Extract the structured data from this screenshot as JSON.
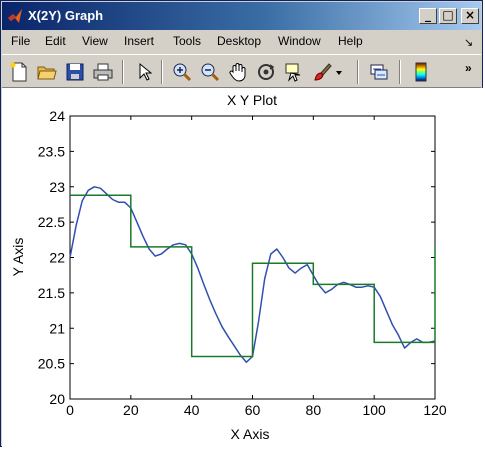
{
  "window": {
    "title": "X(2Y)  Graph",
    "minimize_label": "_",
    "maximize_label": "□",
    "close_label": "×"
  },
  "menu": {
    "items": [
      "File",
      "Edit",
      "View",
      "Insert",
      "Tools",
      "Desktop",
      "Window",
      "Help"
    ],
    "overflow_label": "↘"
  },
  "toolbar": {
    "icons": [
      "new-file-icon",
      "open-folder-icon",
      "save-icon",
      "print-icon",
      "pointer-icon",
      "zoom-in-icon",
      "zoom-out-icon",
      "pan-hand-icon",
      "rotate-3d-icon",
      "data-cursor-icon",
      "brush-icon",
      "dropdown-arrow-icon",
      "link-plot-icon",
      "colorbar-icon"
    ],
    "overflow_label": "»"
  },
  "chart_data": {
    "type": "line",
    "title": "X Y Plot",
    "xlabel": "X Axis",
    "ylabel": "Y Axis",
    "xlim": [
      0,
      120
    ],
    "ylim": [
      20,
      24
    ],
    "xticks": [
      "0",
      "20",
      "40",
      "60",
      "80",
      "100",
      "120"
    ],
    "yticks": [
      "20",
      "20.5",
      "21",
      "21.5",
      "22",
      "22.5",
      "23",
      "23.5",
      "24"
    ],
    "grid": false,
    "series": [
      {
        "color": "#3050b0",
        "x": [
          0,
          2,
          4,
          6,
          8,
          10,
          12,
          14,
          16,
          18,
          20,
          22,
          24,
          26,
          28,
          30,
          32,
          34,
          36,
          38,
          40,
          42,
          44,
          46,
          48,
          50,
          52,
          54,
          56,
          58,
          60,
          62,
          64,
          66,
          68,
          70,
          72,
          74,
          76,
          78,
          80,
          82,
          84,
          86,
          88,
          90,
          92,
          94,
          96,
          98,
          100,
          102,
          104,
          106,
          108,
          110,
          112,
          114,
          116,
          118,
          120
        ],
        "y": [
          22.0,
          22.45,
          22.8,
          22.95,
          23.0,
          22.98,
          22.9,
          22.82,
          22.78,
          22.78,
          22.7,
          22.5,
          22.3,
          22.12,
          22.02,
          22.05,
          22.12,
          22.18,
          22.2,
          22.18,
          22.05,
          21.85,
          21.62,
          21.4,
          21.2,
          21.02,
          20.88,
          20.75,
          20.62,
          20.52,
          20.6,
          21.1,
          21.7,
          22.05,
          22.12,
          22.0,
          21.85,
          21.78,
          21.85,
          21.9,
          21.75,
          21.6,
          21.5,
          21.55,
          21.62,
          21.65,
          21.62,
          21.58,
          21.58,
          21.6,
          21.58,
          21.45,
          21.25,
          21.05,
          20.9,
          20.72,
          20.8,
          20.85,
          20.8,
          20.8,
          20.82
        ]
      },
      {
        "color": "#1a7a2a",
        "step_x": [
          0,
          20,
          20,
          40,
          40,
          60,
          60,
          80,
          80,
          100,
          100,
          120,
          120
        ],
        "step_y": [
          22.88,
          22.88,
          22.15,
          22.15,
          20.6,
          20.6,
          21.92,
          21.92,
          21.62,
          21.62,
          20.8,
          20.8,
          22.15
        ]
      }
    ]
  }
}
